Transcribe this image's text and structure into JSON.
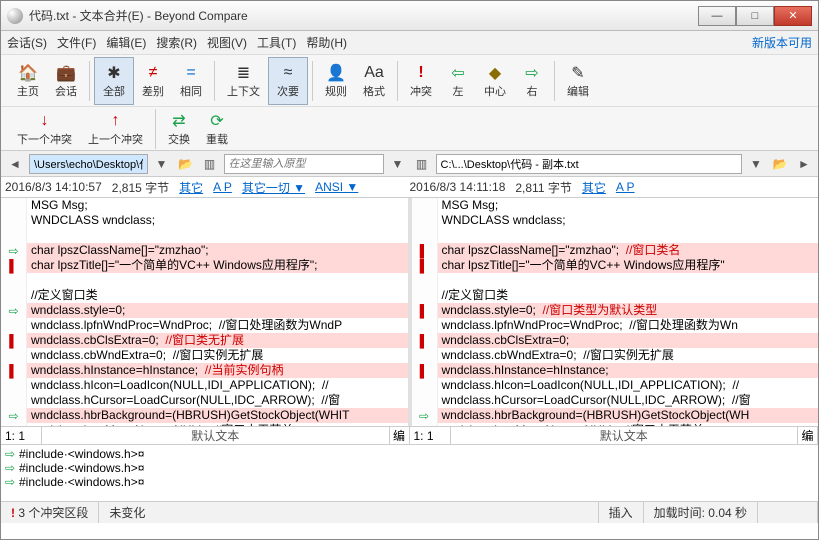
{
  "window": {
    "title": "代码.txt - 文本合并(E) - Beyond Compare"
  },
  "menu": {
    "items": [
      "会话(S)",
      "文件(F)",
      "编辑(E)",
      "搜索(R)",
      "视图(V)",
      "工具(T)",
      "帮助(H)"
    ],
    "new_version": "新版本可用"
  },
  "toolbar": {
    "home": "主页",
    "sessions": "会话",
    "all": "全部",
    "diff": "差别",
    "same": "相同",
    "context": "上下文",
    "minor": "次要",
    "rules": "规则",
    "format": "格式",
    "conflict": "冲突",
    "left": "左",
    "center": "中心",
    "right": "右",
    "edit": "编辑"
  },
  "toolbar2": {
    "prev_conflict": "下一个冲突",
    "next_conflict": "上一个冲突",
    "swap": "交换",
    "reload": "重载"
  },
  "paths": {
    "left": "\\Users\\echo\\Desktop\\代码.txt",
    "right": "C:\\...\\Desktop\\代码 - 副本.txt",
    "filter_placeholder": "在这里输入原型"
  },
  "info": {
    "left": {
      "date": "2016/8/3 14:10:57",
      "size": "2,815 字节",
      "other": "其它",
      "ap": "A  P",
      "all_other": "其它一切 ▼",
      "enc": "ANSI ▼"
    },
    "right": {
      "date": "2016/8/3 14:11:18",
      "size": "2,811 字节",
      "other": "其它",
      "ap": "A  P"
    }
  },
  "code_left": [
    {
      "t": "MSG Msg;",
      "d": false
    },
    {
      "t": "WNDCLASS wndclass;",
      "d": false
    },
    {
      "t": "",
      "d": false
    },
    {
      "t": "char lpszClassName[]=\"zmzhao\";",
      "d": true
    },
    {
      "t": "char lpszTitle[]=\"一个简单的VC++ Windows应用程序\";",
      "d": true
    },
    {
      "t": "",
      "d": false
    },
    {
      "t": "//定义窗口类",
      "d": false
    },
    {
      "t": "wndclass.style=0;",
      "d": true
    },
    {
      "t": "wndclass.lpfnWndProc=WndProc;  //窗口处理函数为WndP",
      "d": false
    },
    {
      "t": "wndclass.cbClsExtra=0;  ",
      "d": true,
      "r": "//窗口类无扩展"
    },
    {
      "t": "wndclass.cbWndExtra=0;  //窗口实例无扩展",
      "d": false
    },
    {
      "t": "wndclass.hInstance=hInstance;  ",
      "d": true,
      "r": "//当前实例句柄"
    },
    {
      "t": "wndclass.hIcon=LoadIcon(NULL,IDI_APPLICATION);  //",
      "d": false
    },
    {
      "t": "wndclass.hCursor=LoadCursor(NULL,IDC_ARROW);  //窗",
      "d": false
    },
    {
      "t": "wndclass.hbrBackground=(HBRUSH)GetStockObject(WHIT",
      "d": true
    },
    {
      "t": "wndclass.lpszMenuName=NULL;  //窗口由无菜单",
      "d": false
    }
  ],
  "code_right": [
    {
      "t": "MSG Msg;",
      "d": false
    },
    {
      "t": "WNDCLASS wndclass;",
      "d": false
    },
    {
      "t": "",
      "d": false
    },
    {
      "t": "char lpszClassName[]=\"zmzhao\";  ",
      "d": true,
      "r": "//窗口类名"
    },
    {
      "t": "char lpszTitle[]=\"一个简单的VC++ Windows应用程序\"",
      "d": true
    },
    {
      "t": "",
      "d": false
    },
    {
      "t": "//定义窗口类",
      "d": false
    },
    {
      "t": "wndclass.style=0;  ",
      "d": true,
      "r": "//窗口类型为默认类型"
    },
    {
      "t": "wndclass.lpfnWndProc=WndProc;  //窗口处理函数为Wn",
      "d": false
    },
    {
      "t": "wndclass.cbClsExtra=0;",
      "d": true
    },
    {
      "t": "wndclass.cbWndExtra=0;  //窗口实例无扩展",
      "d": false
    },
    {
      "t": "wndclass.hInstance=hInstance;",
      "d": true
    },
    {
      "t": "wndclass.hIcon=LoadIcon(NULL,IDI_APPLICATION);  //",
      "d": false
    },
    {
      "t": "wndclass.hCursor=LoadCursor(NULL,IDC_ARROW);  //窗",
      "d": false
    },
    {
      "t": "wndclass.hbrBackground=(HBRUSH)GetStockObject(WH",
      "d": true
    },
    {
      "t": "wndclass.lpszMenuName=NULL;  //窗口由无菜单",
      "d": false
    }
  ],
  "gutters_left": [
    "",
    "",
    "",
    "⇨",
    "▌",
    "",
    "",
    "⇨",
    "",
    "▌",
    "",
    "▌",
    "",
    "",
    "⇨",
    ""
  ],
  "gutters_right": [
    "",
    "",
    "",
    "▌",
    "▌",
    "",
    "",
    "▌",
    "",
    "▌",
    "",
    "▌",
    "",
    "",
    "⇨",
    ""
  ],
  "posbar": {
    "pos": "1: 1",
    "default_text": "默认文本",
    "ed": "编"
  },
  "merged": [
    "#include·<windows.h>¤",
    "#include·<windows.h>¤",
    "#include·<windows.h>¤"
  ],
  "statusbar": {
    "conflicts": "3 个冲突区段",
    "unchanged": "未变化",
    "insert": "插入",
    "loadtime": "加载时间: 0.04 秒"
  }
}
